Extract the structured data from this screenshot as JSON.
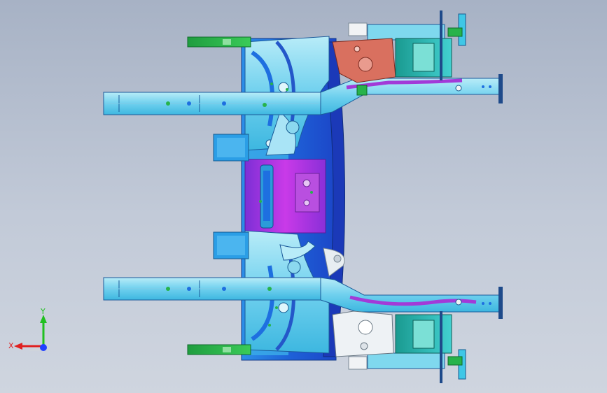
{
  "viewport": {
    "background_top": "#a7b2c5",
    "background_bottom": "#cfd5df"
  },
  "model": {
    "palette": {
      "cyan": "#3fc7e6",
      "light_cyan": "#8fdcf0",
      "blue": "#1e6fe0",
      "deep_blue": "#1b46c9",
      "purple": "#a23ad8",
      "magenta": "#cf35e8",
      "green": "#27b34b",
      "teal": "#1aa79a",
      "salmon": "#d9705f",
      "white": "#f1f3f5"
    }
  },
  "triad": {
    "x_label": "X",
    "y_label": "Y",
    "x_color": "#e02020",
    "y_color": "#20c020",
    "z_color": "#2040ff"
  }
}
